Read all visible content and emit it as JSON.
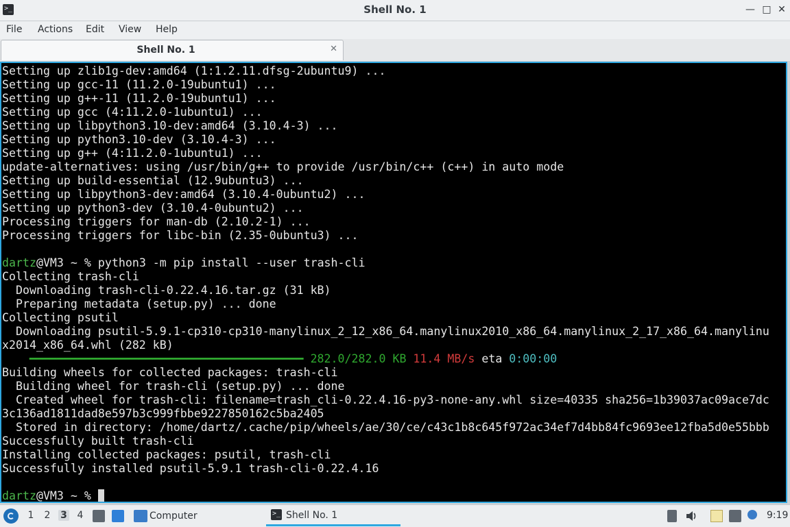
{
  "window": {
    "title": "Shell No. 1",
    "app_icon_glyph": ">_",
    "minimize": "—",
    "maximize": "□",
    "close": "✕"
  },
  "menubar": {
    "items": [
      "File",
      "Actions",
      "Edit",
      "View",
      "Help"
    ]
  },
  "tab": {
    "label": "Shell No. 1",
    "close": "✕"
  },
  "terminal": {
    "lines": [
      "Setting up zlib1g-dev:amd64 (1:1.2.11.dfsg-2ubuntu9) ...",
      "Setting up gcc-11 (11.2.0-19ubuntu1) ...",
      "Setting up g++-11 (11.2.0-19ubuntu1) ...",
      "Setting up gcc (4:11.2.0-1ubuntu1) ...",
      "Setting up libpython3.10-dev:amd64 (3.10.4-3) ...",
      "Setting up python3.10-dev (3.10.4-3) ...",
      "Setting up g++ (4:11.2.0-1ubuntu1) ...",
      "update-alternatives: using /usr/bin/g++ to provide /usr/bin/c++ (c++) in auto mode",
      "Setting up build-essential (12.9ubuntu3) ...",
      "Setting up libpython3-dev:amd64 (3.10.4-0ubuntu2) ...",
      "Setting up python3-dev (3.10.4-0ubuntu2) ...",
      "Processing triggers for man-db (2.10.2-1) ...",
      "Processing triggers for libc-bin (2.35-0ubuntu3) ...",
      "",
      {
        "prompt_user": "dartz",
        "prompt_rest": "@VM3 ~ % ",
        "command": "python3 -m pip install --user trash-cli"
      },
      "Collecting trash-cli",
      "  Downloading trash-cli-0.22.4.16.tar.gz (31 kB)",
      "  Preparing metadata (setup.py) ... done",
      "Collecting psutil",
      "  Downloading psutil-5.9.1-cp310-cp310-manylinux_2_12_x86_64.manylinux2010_x86_64.manylinux_2_17_x86_64.manylinu",
      "x2014_x86_64.whl (282 kB)",
      {
        "progress_bar": "    ━━━━━━━━━━━━━━━━━━━━━━━━━━━━━━━━━━━━━━━━",
        "downloaded": "282.0/282.0 KB",
        "speed": "11.4 MB/s",
        "eta_label": "eta",
        "eta": "0:00:00"
      },
      "Building wheels for collected packages: trash-cli",
      "  Building wheel for trash-cli (setup.py) ... done",
      "  Created wheel for trash-cli: filename=trash_cli-0.22.4.16-py3-none-any.whl size=40335 sha256=1b39037ac09ace7dc",
      "3c136ad1811dad8e597b3c999fbbe9227850162c5ba2405",
      "  Stored in directory: /home/dartz/.cache/pip/wheels/ae/30/ce/c43c1b8c645f972ac34ef7d4bb84fc9693ee12fba5d0e55bbb",
      "Successfully built trash-cli",
      "Installing collected packages: psutil, trash-cli",
      "Successfully installed psutil-5.9.1 trash-cli-0.22.4.16",
      "",
      {
        "prompt_user": "dartz",
        "prompt_rest": "@VM3 ~ % ",
        "command": "",
        "cursor": true
      }
    ],
    "colors": {
      "background": "#000000",
      "text": "#e6e6e6",
      "prompt_user": "#4bb54b",
      "progress": "#2fa82f",
      "speed": "#d23b3b",
      "eta": "#4ebdc0",
      "focus_border": "#2ea7e0"
    }
  },
  "taskbar": {
    "workspaces": [
      "1",
      "2",
      "3",
      "4"
    ],
    "active_workspace": "3",
    "computer_label": "Computer",
    "window_label": "Shell No. 1",
    "clock": "9:19",
    "icons": [
      "start-menu-icon",
      "trash-icon",
      "show-desktop-icon",
      "folder-icon",
      "clipboard-icon",
      "volume-icon",
      "notes-icon",
      "network-icon",
      "update-icon"
    ]
  }
}
